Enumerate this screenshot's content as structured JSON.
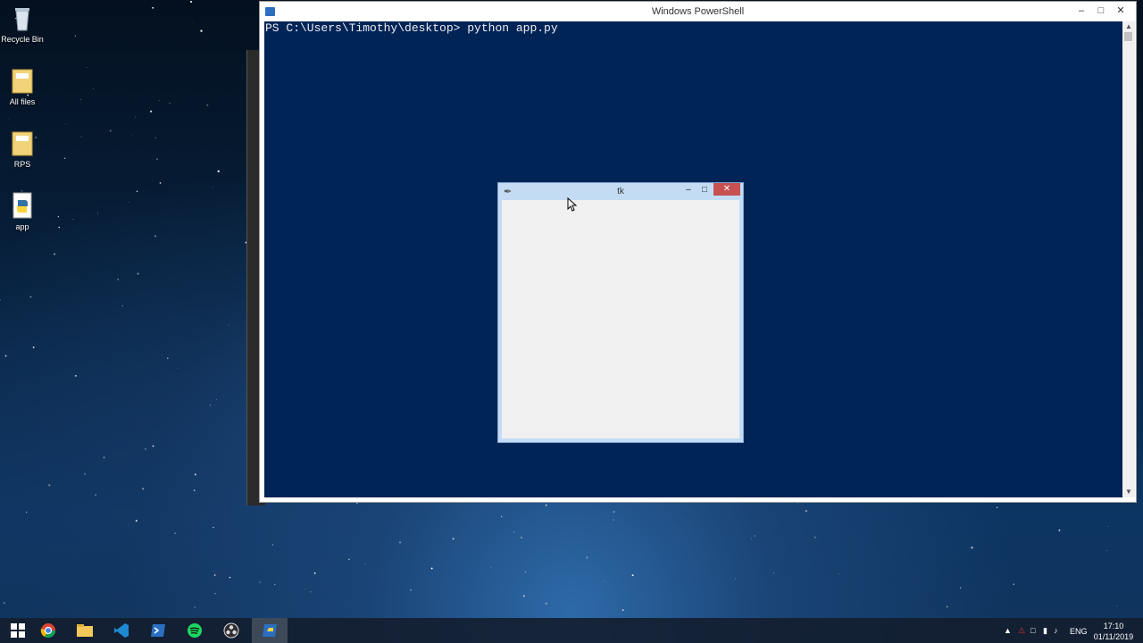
{
  "desktop": {
    "icons": [
      {
        "label": "Recycle Bin",
        "icon": "recycle-bin-icon"
      },
      {
        "label": "All files",
        "icon": "folder-icon"
      },
      {
        "label": "RPS",
        "icon": "folder-icon"
      },
      {
        "label": "app",
        "icon": "python-file-icon"
      }
    ]
  },
  "powershell": {
    "title": "Windows PowerShell",
    "console_text": "PS C:\\Users\\Timothy\\desktop> python app.py",
    "console_bg": "#012456",
    "console_fg": "#eeedf0"
  },
  "tk_window": {
    "title": "tk",
    "client_bg": "#f0f0f0"
  },
  "taskbar": {
    "items": [
      "start-icon",
      "chrome-icon",
      "file-explorer-icon",
      "vscode-icon",
      "powershell-icon",
      "spotify-icon",
      "obs-icon",
      "python-icon"
    ],
    "tray": {
      "language": "ENG",
      "time": "17:10",
      "date": "01/11/2019"
    }
  }
}
